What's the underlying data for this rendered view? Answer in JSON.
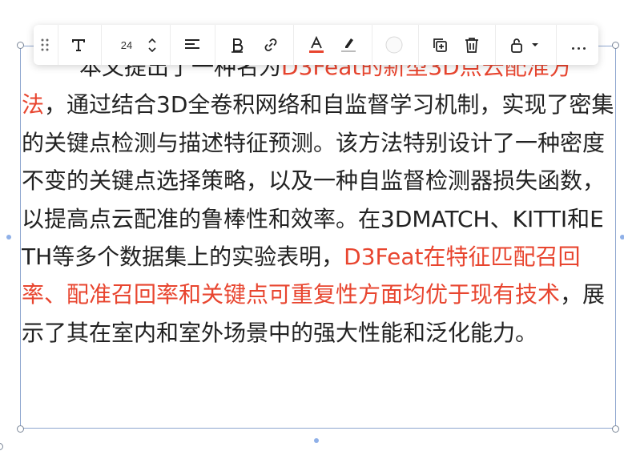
{
  "toolbar": {
    "font_size": "24",
    "text_color": "#e8452f",
    "icons": [
      "drag-handle-icon",
      "text-type-icon",
      "font-size-up-icon",
      "font-size-down-icon",
      "align-left-icon",
      "bold-icon",
      "link-icon",
      "font-color-icon",
      "highlight-icon",
      "fill-circle-icon",
      "duplicate-icon",
      "delete-icon",
      "lock-icon",
      "chevron-down-icon",
      "more-icon"
    ]
  },
  "content": {
    "seg1": "本文提出了一种名为",
    "seg2": "D3Feat的新型3D点云配准方法",
    "seg3": "，通过结合3D全卷积网络和自监督学习机制，实现了密集的关键点检测与描述特征预测。该方法特别设计了一种密度不变的关键点选择策略，以及一种自监督检测器损失函数，以提高点云配准的鲁棒性和效率。在3DMATCH、KITTI和ETH等多个数据集上的实验表明，",
    "seg4": "D3Feat在特征匹配召回率、配准召回率和关键点可重复性方面均优于现有技术",
    "seg5": "，展示了其在室内和室外场景中的强大性能和泛化能力。",
    "highlight_color": "#e8452f"
  }
}
